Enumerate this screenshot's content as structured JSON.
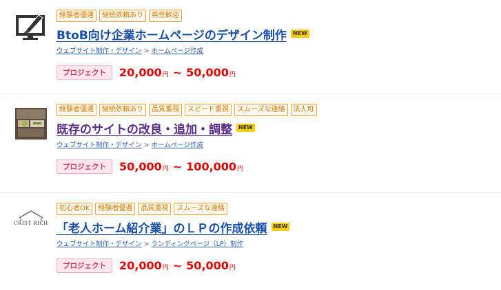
{
  "jobs": [
    {
      "tags": [
        "経験者優遇",
        "継続依頼あり",
        "男性歓迎"
      ],
      "title": "BtoB向け企業ホームページのデザイン制作",
      "badge": "NEW",
      "category": "ウェブサイト制作・デザイン",
      "subcategory": "ホームページ作成",
      "type": "プロジェクト",
      "price_min": "20,000",
      "price_max": "50,000",
      "currency": "円",
      "thumb_icon": "monitor-pen-icon"
    },
    {
      "tags": [
        "経験者優遇",
        "継続依頼あり",
        "品質重視",
        "スピード重視",
        "スムーズな連絡",
        "法人可"
      ],
      "title": "既存のサイトの改良・追加・調整",
      "badge": "NEW",
      "category": "ウェブサイト制作・デザイン",
      "subcategory": "ホームページ作成",
      "type": "プロジェクト",
      "price_min": "50,000",
      "price_max": "100,000",
      "currency": "円",
      "thumb_icon": "photo-thumbnail"
    },
    {
      "tags": [
        "初心者OK",
        "経験者優遇",
        "品質重視",
        "スムーズな連絡"
      ],
      "title": "「老人ホーム紹介業」のＬＰの作成依頼",
      "badge": "NEW",
      "category": "ウェブサイト制作・デザイン",
      "subcategory": "ランディングページ（LP）制作",
      "type": "プロジェクト",
      "price_min": "20,000",
      "price_max": "50,000",
      "currency": "円",
      "thumb_icon": "crist-rich-logo",
      "thumb_logo_text": "CRIST RICH"
    }
  ],
  "separator": ">",
  "tilde": "~",
  "colors": {
    "tag": "#e07b00",
    "title": "#1a4fa8",
    "price": "#e00000",
    "badge": "#ffcc00",
    "type_bg": "#fde6ee"
  }
}
